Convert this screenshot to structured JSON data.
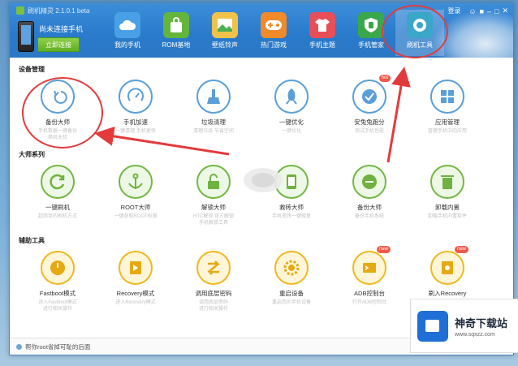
{
  "window": {
    "title": "刷机精灵 2.1.0.1 beta"
  },
  "header": {
    "connect_text": "尚未连接手机",
    "connect_button": "立即连接",
    "tabs": [
      {
        "label": "我的手机",
        "icon": "cloud-icon",
        "color": "#4aa0e6"
      },
      {
        "label": "ROM基地",
        "icon": "shopping-bag-icon",
        "color": "#64b53c"
      },
      {
        "label": "壁纸铃声",
        "icon": "wallpaper-icon",
        "color": "#f0c24a"
      },
      {
        "label": "热门游戏",
        "icon": "gamepad-icon",
        "color": "#f08a2a"
      },
      {
        "label": "手机主题",
        "icon": "tshirt-icon",
        "color": "#e84e57"
      },
      {
        "label": "手机管家",
        "icon": "shield-icon",
        "color": "#39a84a"
      },
      {
        "label": "刷机工具",
        "icon": "wrench-icon",
        "color": "#3aa6c8"
      }
    ],
    "user": "登录"
  },
  "sections": [
    {
      "title": "设备管理",
      "tools": [
        {
          "name": "备份大师",
          "desc": "手机数据一键备份\n换机无忧",
          "style": "blue",
          "icon": "backup-icon"
        },
        {
          "name": "手机加速",
          "desc": "一键清理 手机更快",
          "style": "blue",
          "icon": "speedometer-icon"
        },
        {
          "name": "垃圾清理",
          "desc": "清理垃圾 节省空间",
          "style": "blue",
          "icon": "broom-icon"
        },
        {
          "name": "一键优化",
          "desc": "一键优化",
          "style": "blue",
          "icon": "rocket-icon"
        },
        {
          "name": "安兔兔跑分",
          "desc": "测试手机性能",
          "style": "blue",
          "icon": "benchmark-icon",
          "badge": "hot"
        },
        {
          "name": "应用管理",
          "desc": "管理手机中的应用",
          "style": "blue",
          "icon": "apps-grid-icon"
        }
      ]
    },
    {
      "title": "大师系列",
      "tools": [
        {
          "name": "一键刷机",
          "desc": "超简单的刷机方式",
          "style": "green",
          "icon": "refresh-icon"
        },
        {
          "name": "ROOT大师",
          "desc": "一键获取ROOT权限",
          "style": "green",
          "icon": "anchor-icon"
        },
        {
          "name": "解锁大师",
          "desc": "HTC解锁 官方解锁\n手机解锁工具",
          "style": "green",
          "icon": "unlock-icon"
        },
        {
          "name": "救砖大师",
          "desc": "手机变砖一键修复",
          "style": "green",
          "icon": "repair-icon"
        },
        {
          "name": "备份大师",
          "desc": "备份手机系统",
          "style": "green",
          "icon": "backup-disk-icon"
        },
        {
          "name": "卸载内置",
          "desc": "卸载手机内置软件",
          "style": "green",
          "icon": "trash-icon"
        }
      ]
    },
    {
      "title": "辅助工具",
      "tools": [
        {
          "name": "Fastboot模式",
          "desc": "进入Fastboot模式\n进行相关操作",
          "style": "yellow",
          "icon": "power-icon"
        },
        {
          "name": "Recovery模式",
          "desc": "进入Recovery模式",
          "style": "yellow",
          "icon": "recovery-icon"
        },
        {
          "name": "调用底层密码",
          "desc": "调用底层密码\n进行相关操作",
          "style": "yellow",
          "icon": "transfer-icon"
        },
        {
          "name": "重启设备",
          "desc": "重启您的手机设备",
          "style": "yellow",
          "icon": "gear-icon"
        },
        {
          "name": "ADB控制台",
          "desc": "打开ADB控制台",
          "style": "yellow",
          "icon": "console-icon",
          "badge": "new"
        },
        {
          "name": "刷入Recovery",
          "desc": "刷入第三方Recovery",
          "style": "yellow",
          "icon": "flash-recovery-icon",
          "badge": "new"
        }
      ]
    }
  ],
  "status": {
    "text": "帮你root省掉可耻的后面"
  },
  "watermark": {
    "title": "神奇下载站",
    "url": "www.sqxzz.com"
  },
  "colors": {
    "annotation": "#e23b3b",
    "header": "#2a7bcc"
  }
}
